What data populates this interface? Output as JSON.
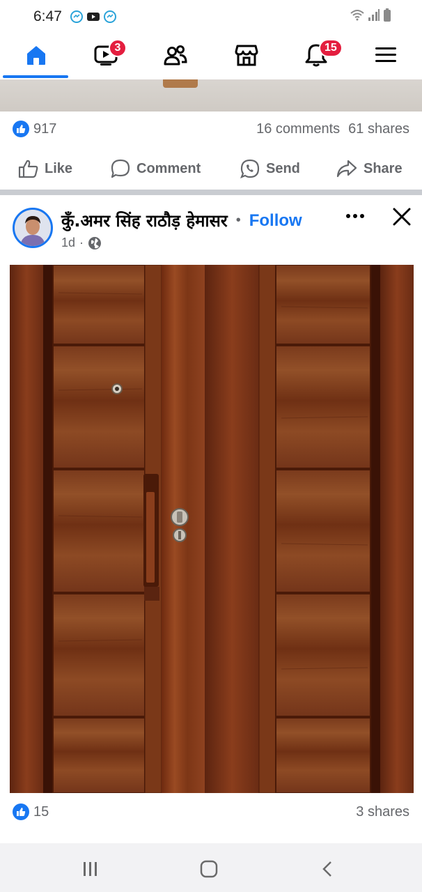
{
  "status_bar": {
    "time": "6:47"
  },
  "nav": {
    "items": [
      {
        "name": "home",
        "active": true
      },
      {
        "name": "video",
        "badge": "3"
      },
      {
        "name": "friends"
      },
      {
        "name": "marketplace"
      },
      {
        "name": "notifications",
        "badge": "15"
      },
      {
        "name": "menu"
      }
    ],
    "accent": "#1877f2",
    "badge_color": "#e41e3f"
  },
  "previous_post": {
    "reactions_count": "917",
    "comments": "16 comments",
    "shares": "61 shares",
    "actions": {
      "like": "Like",
      "comment": "Comment",
      "send": "Send",
      "share": "Share"
    }
  },
  "post": {
    "author": "कुँ.अमर सिंह राठौड़ हेमासर",
    "separator": "•",
    "follow_label": "Follow",
    "time": "1d",
    "privacy_icon": "globe-icon",
    "image_subject": "wooden-double-door",
    "reactions_count": "15",
    "shares": "3 shares"
  }
}
